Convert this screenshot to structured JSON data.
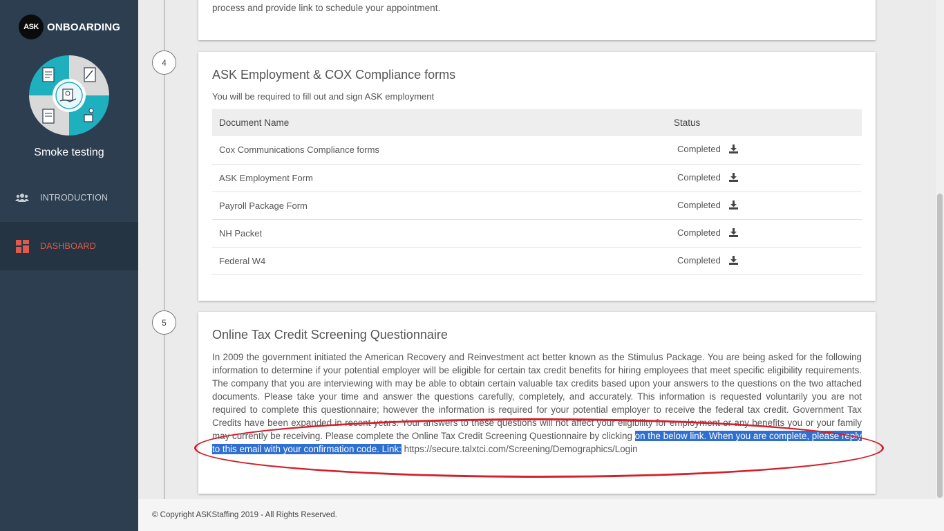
{
  "sidebar": {
    "logo_text": "ASK",
    "brand_title": "ONBOARDING",
    "user_name": "Smoke testing",
    "nav": [
      {
        "label": "INTRODUCTION",
        "icon": "users-icon"
      },
      {
        "label": "DASHBOARD",
        "icon": "dashboard-icon",
        "active": true
      }
    ]
  },
  "prev_card": {
    "text": "process and provide link to schedule your appointment."
  },
  "steps": {
    "step4": {
      "number": "4",
      "title": "ASK Employment & COX Compliance forms",
      "subtitle": "You will be required to fill out and sign ASK employment",
      "columns": [
        "Document Name",
        "Status"
      ],
      "rows": [
        {
          "name": "Cox Communications Compliance forms",
          "status": "Completed"
        },
        {
          "name": "ASK Employment Form",
          "status": "Completed"
        },
        {
          "name": "Payroll Package Form",
          "status": "Completed"
        },
        {
          "name": "NH Packet",
          "status": "Completed"
        },
        {
          "name": "Federal W4",
          "status": "Completed"
        }
      ]
    },
    "step5": {
      "number": "5",
      "title": "Online Tax Credit Screening Questionnaire",
      "body": "In 2009 the government initiated the American Recovery and Reinvestment act better known as the Stimulus Package. You are being asked for the following information to determine if your potential employer will be eligible for certain tax credit benefits for hiring employees that meet specific eligibility requirements. The company that you are interviewing with may be able to obtain certain valuable tax credits based upon your answers to the questions on the two attached documents. Please take your time and answer the questions carefully, completely, and accurately. This information is requested voluntarily you are not required to complete this questionnaire; however the information is required for your potential employer to receive the federal tax credit. Government Tax Credits have been expanded in recent years. Your answers to these questions will not affect your eligibility for employment or any benefits you or your family may currently be receiving. Please complete the Online Tax Credit Screening Questionnaire by clicking",
      "selected": "on the below link. When you are complete, please reply to this email with your confirmation code. Link:",
      "link": "https://secure.talxtci.com/Screening/Demographics/Login"
    }
  },
  "footer": {
    "copyright": "© Copyright ASKStaffing 2019 - All Rights Reserved."
  },
  "colors": {
    "sidebar_bg": "#2c3e50",
    "active_nav": "#e05a4b",
    "selection": "#2f6fcf",
    "annotation": "#d3202a",
    "avatar_teal": "#1fb0bf"
  }
}
